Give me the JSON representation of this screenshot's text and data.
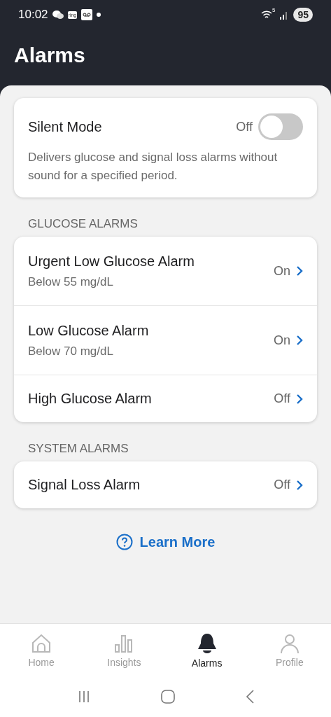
{
  "status_bar": {
    "time": "10:02",
    "app_badge": "ring",
    "wifi_label": "5",
    "battery": "95"
  },
  "header": {
    "title": "Alarms"
  },
  "silent_mode": {
    "title": "Silent Mode",
    "state_label": "Off",
    "on": false,
    "description": "Delivers glucose and signal loss alarms without sound for a specified period."
  },
  "sections": [
    {
      "title": "GLUCOSE ALARMS",
      "items": [
        {
          "title": "Urgent Low Glucose Alarm",
          "subtitle": "Below 55 mg/dL",
          "state_label": "On"
        },
        {
          "title": "Low Glucose Alarm",
          "subtitle": "Below 70 mg/dL",
          "state_label": "On"
        },
        {
          "title": "High Glucose Alarm",
          "state_label": "Off"
        }
      ]
    },
    {
      "title": "SYSTEM ALARMS",
      "items": [
        {
          "title": "Signal Loss Alarm",
          "state_label": "Off"
        }
      ]
    }
  ],
  "learn_more": {
    "label": "Learn More"
  },
  "tabs": [
    {
      "label": "Home",
      "kind": "home",
      "selected": false
    },
    {
      "label": "Insights",
      "kind": "insights",
      "selected": false
    },
    {
      "label": "Alarms",
      "kind": "alarms",
      "selected": true
    },
    {
      "label": "Profile",
      "kind": "profile",
      "selected": false
    }
  ]
}
